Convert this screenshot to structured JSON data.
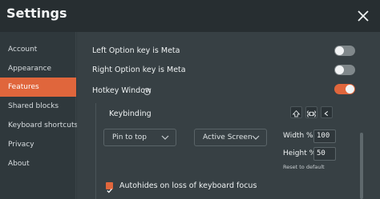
{
  "window": {
    "title": "Settings"
  },
  "sidebar": {
    "items": [
      {
        "label": "Account"
      },
      {
        "label": "Appearance"
      },
      {
        "label": "Features",
        "active": true
      },
      {
        "label": "Shared blocks"
      },
      {
        "label": "Keyboard shortcuts"
      },
      {
        "label": "Privacy"
      },
      {
        "label": "About"
      }
    ]
  },
  "features": {
    "left_option_meta": {
      "label": "Left Option key is Meta",
      "enabled": false
    },
    "right_option_meta": {
      "label": "Right Option key is Meta",
      "enabled": false
    },
    "hotkey_window": {
      "label": "Hotkey Window",
      "enabled": true,
      "info_icon": "info-icon"
    },
    "keybinding": {
      "label": "Keybinding",
      "keys": [
        {
          "icon": "shift-icon",
          "glyph": "⇧"
        },
        {
          "icon": "command-icon",
          "glyph": "⌘"
        },
        {
          "icon": "key-less-than-icon",
          "glyph": "<"
        }
      ]
    },
    "position_select": {
      "value": "Pin to top"
    },
    "screen_select": {
      "value": "Active Screen"
    },
    "width": {
      "label": "Width %",
      "value": "100"
    },
    "height": {
      "label": "Height %",
      "value": "50"
    },
    "reset_label": "Reset to default",
    "autohide": {
      "label": "Autohides on loss of keyboard focus",
      "checked": true
    }
  },
  "colors": {
    "accent": "#e0663c",
    "background": "#374044",
    "titlebar": "#272e31",
    "sidebar": "#2f383c"
  }
}
